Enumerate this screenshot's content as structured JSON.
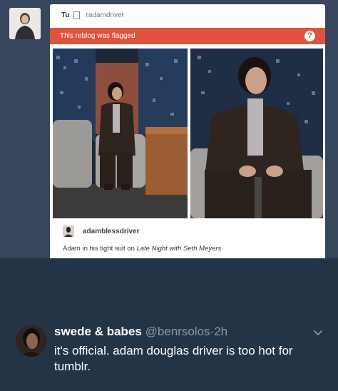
{
  "post": {
    "reblogger": "Tu",
    "source_blog": "radamdriver",
    "flag_message": "This reblog was flagged",
    "help_glyph": "?",
    "reblog_from": "adamblessdriver",
    "caption_prefix": "Adam in his tight suit on ",
    "caption_show": "Late Night with Seth Meyers"
  },
  "tweet": {
    "display_name": "swede & babes",
    "handle": "@benrsolos",
    "separator": "·",
    "time": "2h",
    "text": "it's official. adam douglas driver is too hot for tumblr.",
    "icons": [
      "chevron-down-icon"
    ]
  },
  "colors": {
    "dashboard_bg": "#36465d",
    "flag_red": "#e0523d",
    "tweet_bg": "#243447",
    "tweet_secondary": "#8899a6"
  }
}
